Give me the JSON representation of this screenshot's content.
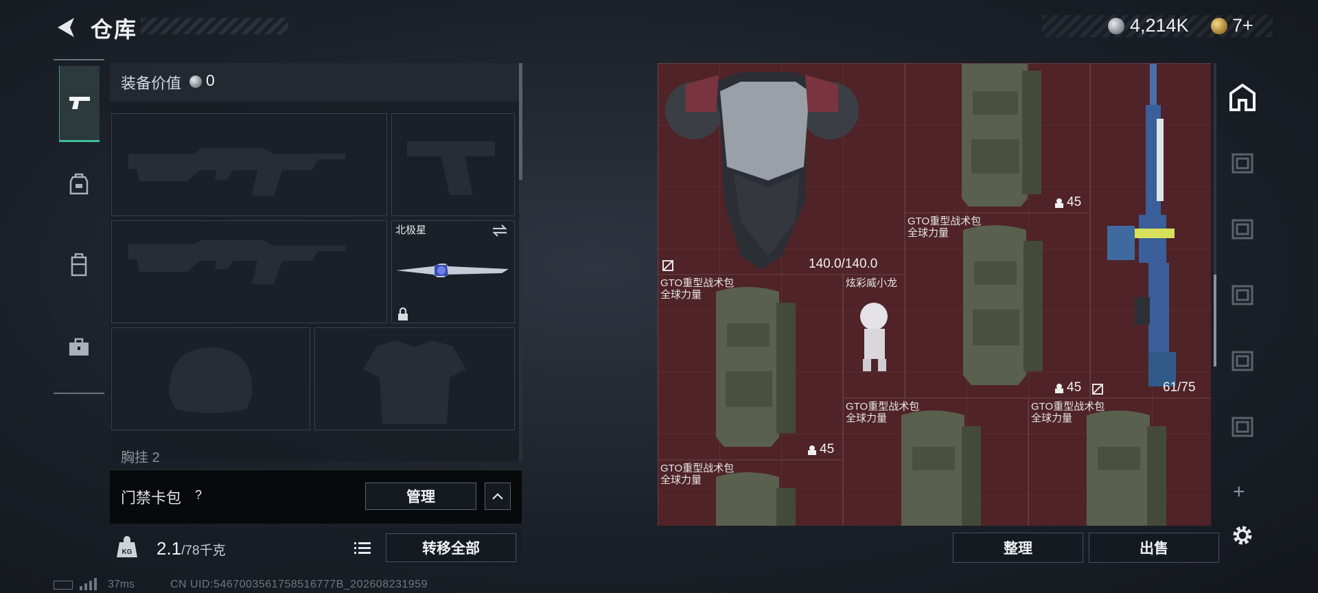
{
  "header": {
    "title": "仓库",
    "currency": "4,214K",
    "tickets": "7+"
  },
  "equipment": {
    "value_label": "装备价值",
    "value": "0",
    "melee_name": "北极星",
    "chest_peek": "胸挂",
    "chest_peek_count": "2"
  },
  "keycard": {
    "label": "门禁卡包",
    "help": "?",
    "manage": "管理"
  },
  "weight": {
    "current": "2.1",
    "max": "/78千克",
    "transfer_all": "转移全部"
  },
  "status": {
    "ping": "37ms",
    "uid": "CN UID:5467003561758516777B_202608231959"
  },
  "stash": {
    "armor_durability": "140.0/140.0",
    "rifle_ammo": "61/75",
    "bag_name": "GTO重型战术包",
    "bag_sub": "全球力量",
    "bag_capacity": "45",
    "toy_name": "炫彩威小龙",
    "arrange": "整理",
    "sell": "出售"
  },
  "colors": {
    "accent": "#3fbf9f",
    "grid_bg": "#4f2328"
  }
}
